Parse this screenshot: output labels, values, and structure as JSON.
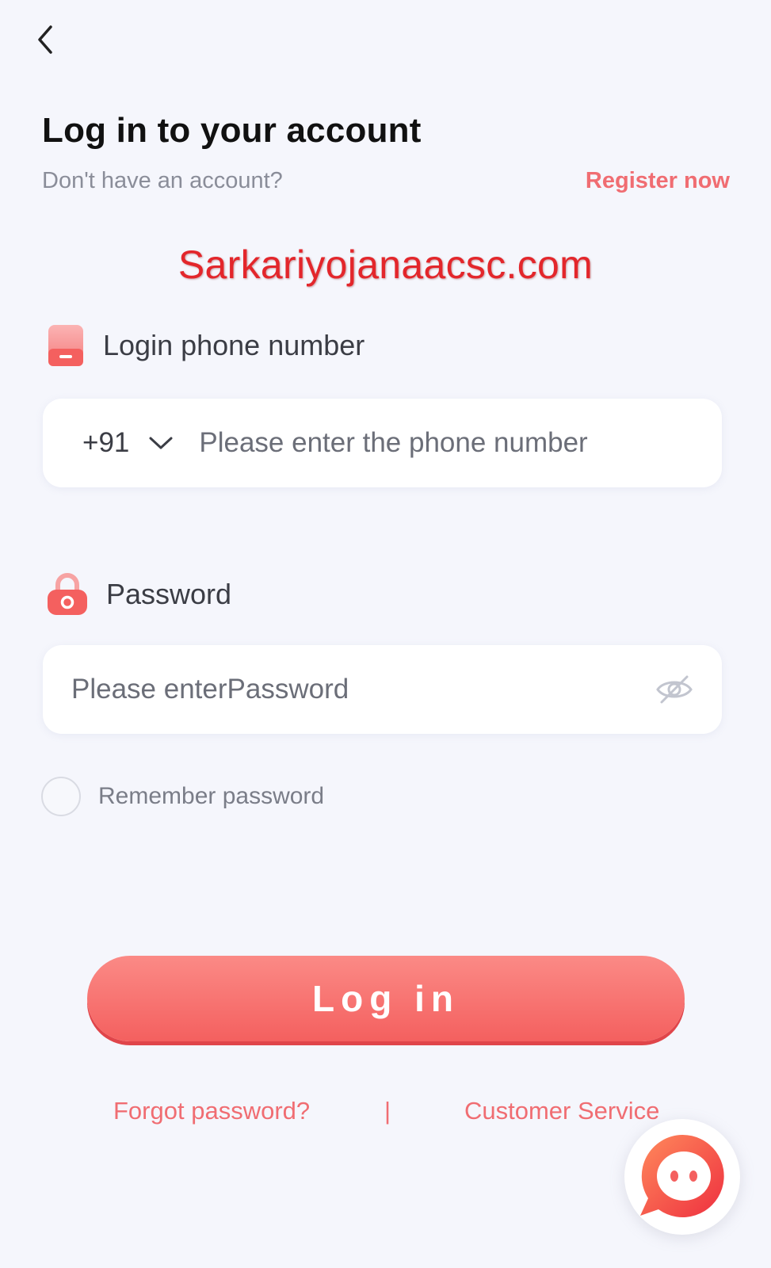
{
  "header": {
    "title": "Log in to your account",
    "no_account_text": "Don't have an account?",
    "register_label": "Register now"
  },
  "watermark": "Sarkariyojanaacsc.com",
  "phone_section": {
    "label": "Login phone number",
    "country_code": "+91",
    "placeholder": "Please enter the phone number",
    "value": ""
  },
  "password_section": {
    "label": "Password",
    "placeholder": "Please enterPassword",
    "value": ""
  },
  "remember": {
    "label": "Remember password",
    "checked": false
  },
  "login_button": {
    "label": "Log in"
  },
  "footer": {
    "forgot_label": "Forgot password?",
    "divider": "|",
    "customer_service_label": "Customer Service"
  },
  "colors": {
    "accent": "#f06d72",
    "button_gradient_top": "#fb8a86",
    "button_gradient_bottom": "#f4605f",
    "watermark": "#e3262b",
    "background": "#f5f6fc"
  },
  "icons": {
    "back": "chevron-left-icon",
    "phone": "phone-icon",
    "password": "lock-icon",
    "dropdown": "chevron-down-icon",
    "visibility": "eye-off-icon",
    "chat": "chat-bubble-icon"
  }
}
